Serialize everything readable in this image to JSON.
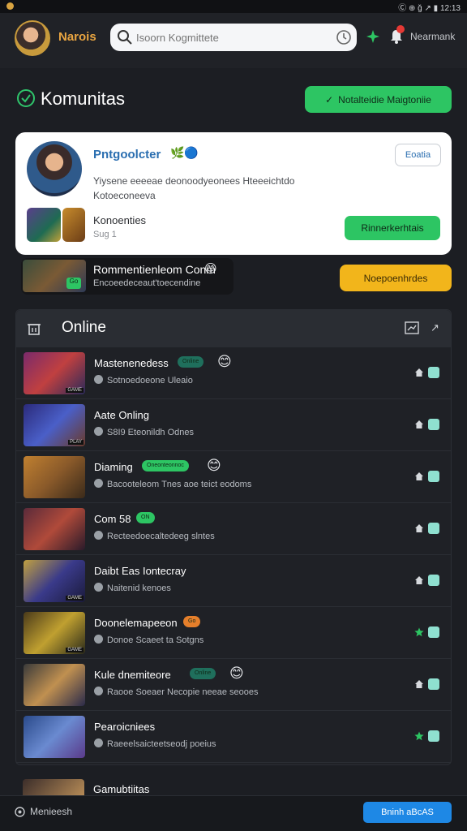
{
  "status_bar": {
    "right_text": "Ⓒ ⊕ ǧ ↗ ▮ 12:13"
  },
  "header": {
    "user_name": "Narois",
    "search_placeholder": "Isoorn Kogmittete",
    "header_link": "Nearmank"
  },
  "page": {
    "title": "Komunitas",
    "primary_action_label": "Notalteidie Maigtoniie"
  },
  "profile_card": {
    "name": "Pntgoolcter",
    "name_icons": "🌿🔵",
    "edit_label": "Eoatia",
    "description_line1": "Yiysene eeeeae deonoodyeonees Hteeeichtdo",
    "description_line2": "Kotoeconeeva",
    "stat_title": "Konoenties",
    "stat_sub": "Sug 1",
    "follow_label": "Rinnerkerhtais"
  },
  "promo": {
    "tag": "Go",
    "title": "Rommentienleom Conm",
    "emoji": "😊",
    "sub": "Encoeedeceaut'toecendine",
    "button_label": "Noepoenhrdes"
  },
  "online": {
    "title": "Online",
    "rows": [
      {
        "name": "Mastenenedess",
        "badge": "Online",
        "badge_color": "#1f6f5c",
        "emoji": "😊",
        "sub": "Sotnoedoeone Uleaio",
        "colors": [
          "#7a2a6b",
          "#c04040",
          "#2a2a5a"
        ],
        "tag": "GAME",
        "act": "home"
      },
      {
        "name": "Aate Onling",
        "badge": "",
        "badge_color": "",
        "emoji": "",
        "sub": "S8I9 Eteonildh Odnes",
        "colors": [
          "#2b2a7a",
          "#4a5fc8",
          "#6a3a2a"
        ],
        "tag": "PLAY",
        "act": "home"
      },
      {
        "name": "Diaming",
        "badge": "Oneonteonnoc",
        "badge_color": "#2dc563",
        "emoji": "😊",
        "sub": "Bacooteleom Tnes aoe teict eodoms",
        "colors": [
          "#c08030",
          "#8a5a2a",
          "#3a2a1a"
        ],
        "tag": "",
        "act": "home"
      },
      {
        "name": "Com 58",
        "badge": "ON",
        "badge_color": "#2dc563",
        "emoji": "",
        "sub": "Recteedoecaltedeeg slntes",
        "colors": [
          "#5a2a3a",
          "#b04a3a",
          "#2a1a2a"
        ],
        "tag": "",
        "act": "home"
      },
      {
        "name": "Daibt Eas Iontecray",
        "badge": "",
        "badge_color": "",
        "emoji": "",
        "sub": "Naitenid kenoes",
        "colors": [
          "#c0a040",
          "#3a3a8a",
          "#1a1a3a"
        ],
        "tag": "GAME",
        "act": "home"
      },
      {
        "name": "Doonelemapeeon",
        "badge": "Go",
        "badge_color": "#e57f2b",
        "emoji": "",
        "sub": "Donoe Scaeet ta Sotgns",
        "colors": [
          "#4a3a1a",
          "#c0a030",
          "#2a2a1a"
        ],
        "tag": "GAME",
        "act": "star"
      },
      {
        "name": "Kule dnemiteore",
        "badge": "Online",
        "badge_color": "#1f6f5c",
        "emoji": "😊",
        "sub": "Raooe Soeaer Necopie neeae seooes",
        "colors": [
          "#3a3a3a",
          "#c09050",
          "#2a2a4a"
        ],
        "tag": "",
        "act": "home"
      },
      {
        "name": "Pearoicniees",
        "badge": "",
        "badge_color": "",
        "emoji": "",
        "sub": "Raeeelsaicteetseodj poeius",
        "colors": [
          "#2a4a8a",
          "#6a8ad0",
          "#5a3a8a"
        ],
        "tag": "",
        "act": "star"
      }
    ]
  },
  "peek": {
    "title": "Gamubtiitas"
  },
  "bottom_bar": {
    "label": "Menieesh",
    "button_label": "Bninh aBcAS"
  },
  "colors": {
    "accent_green": "#2dc563",
    "accent_yellow": "#f2b51b",
    "accent_blue": "#1e88e5",
    "link_blue": "#2a6eb0"
  }
}
